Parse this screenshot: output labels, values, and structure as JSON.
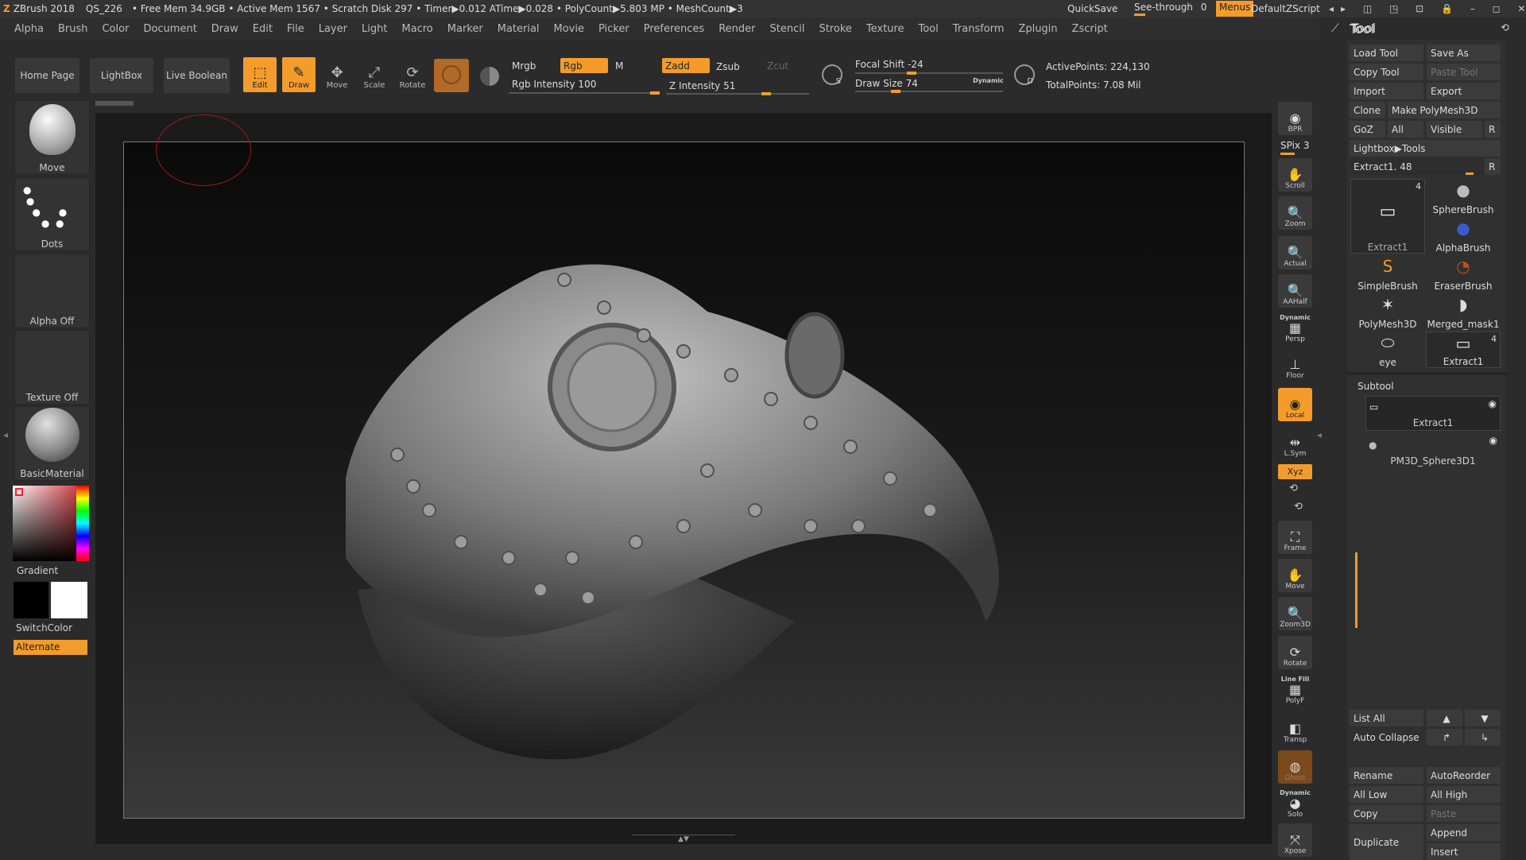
{
  "titlebar": {
    "app": "ZBrush 2018",
    "doc": "QS_226",
    "stats": "• Free Mem 34.9GB • Active Mem 1567 • Scratch Disk 297 • Timer▶0.012 ATime▶0.028 • PolyCount▶5.803 MP • MeshCount▶3",
    "quicksave": "QuickSave",
    "seethrough": "See-through",
    "seethrough_val": "0",
    "menus": "Menus",
    "script": "DefaultZScript"
  },
  "menubar": [
    "Alpha",
    "Brush",
    "Color",
    "Document",
    "Draw",
    "Edit",
    "File",
    "Layer",
    "Light",
    "Macro",
    "Marker",
    "Material",
    "Movie",
    "Picker",
    "Preferences",
    "Render",
    "Stencil",
    "Stroke",
    "Texture",
    "Tool",
    "Transform",
    "Zplugin",
    "Zscript"
  ],
  "toolbar": {
    "home": "Home Page",
    "lightbox": "LightBox",
    "liveboolean": "Live Boolean",
    "edit": "Edit",
    "draw": "Draw",
    "move": "Move",
    "scale": "Scale",
    "rotate": "Rotate",
    "mrgb": "Mrgb",
    "rgb": "Rgb",
    "m": "M",
    "zadd": "Zadd",
    "zsub": "Zsub",
    "zcut": "Zcut",
    "rgb_intensity": "Rgb Intensity 100",
    "z_intensity": "Z Intensity 51",
    "focal_shift": "Focal Shift -24",
    "draw_size": "Draw Size 74",
    "dynamic": "Dynamic",
    "active_points": "ActivePoints: 224,130",
    "total_points": "TotalPoints: 7.08 Mil",
    "rgb_intensity_value": 100,
    "z_intensity_value": 51,
    "focal_shift_value": -24,
    "draw_size_value": 74
  },
  "left": {
    "move": "Move",
    "dots": "Dots",
    "alpha": "Alpha Off",
    "texture": "Texture Off",
    "material": "BasicMaterial",
    "gradient": "Gradient",
    "switchcolor": "SwitchColor",
    "alternate": "Alternate"
  },
  "nav": {
    "bpr": "BPR",
    "spix": "SPix 3",
    "scroll": "Scroll",
    "zoom": "Zoom",
    "actual": "Actual",
    "aahalf": "AAHalf",
    "dynamic": "Dynamic",
    "persp": "Persp",
    "floor": "Floor",
    "local": "Local",
    "lsym": "L.Sym",
    "xyz": "Xyz",
    "frame": "Frame",
    "move": "Move",
    "zoom3d": "Zoom3D",
    "rotate": "Rotate",
    "linefill": "Line Fill",
    "polyf": "PolyF",
    "transp": "Transp",
    "ghost": "Ghost",
    "dynamic2": "Dynamic",
    "solo": "Solo",
    "xpose": "Xpose"
  },
  "toolpanel": {
    "title": "Tool",
    "load": "Load Tool",
    "saveas": "Save As",
    "copytool": "Copy Tool",
    "pastetool": "Paste Tool",
    "import": "Import",
    "export": "Export",
    "clone": "Clone",
    "makepoly": "Make PolyMesh3D",
    "goz": "GoZ",
    "all": "All",
    "visible": "Visible",
    "r": "R",
    "lightbox_tools": "Lightbox▶Tools",
    "extract_slider": "Extract1. 48",
    "tools": [
      {
        "name": "Extract1",
        "badge": "4"
      },
      {
        "name": "SphereBrush"
      },
      {
        "name": "AlphaBrush"
      },
      {
        "name": "SimpleBrush"
      },
      {
        "name": "EraserBrush"
      },
      {
        "name": "PolyMesh3D"
      },
      {
        "name": "Merged_mask1"
      },
      {
        "name": "eye"
      },
      {
        "name": "Extract1",
        "badge": "4"
      }
    ],
    "subtool": "Subtool",
    "subtools": [
      "Extract1",
      "PM3D_Sphere3D1"
    ],
    "listall": "List All",
    "autocollapse": "Auto Collapse",
    "rename": "Rename",
    "autoreorder": "AutoReorder",
    "alllow": "All Low",
    "allhigh": "All High",
    "copy": "Copy",
    "paste": "Paste",
    "duplicate": "Duplicate",
    "append": "Append",
    "insert": "Insert"
  }
}
